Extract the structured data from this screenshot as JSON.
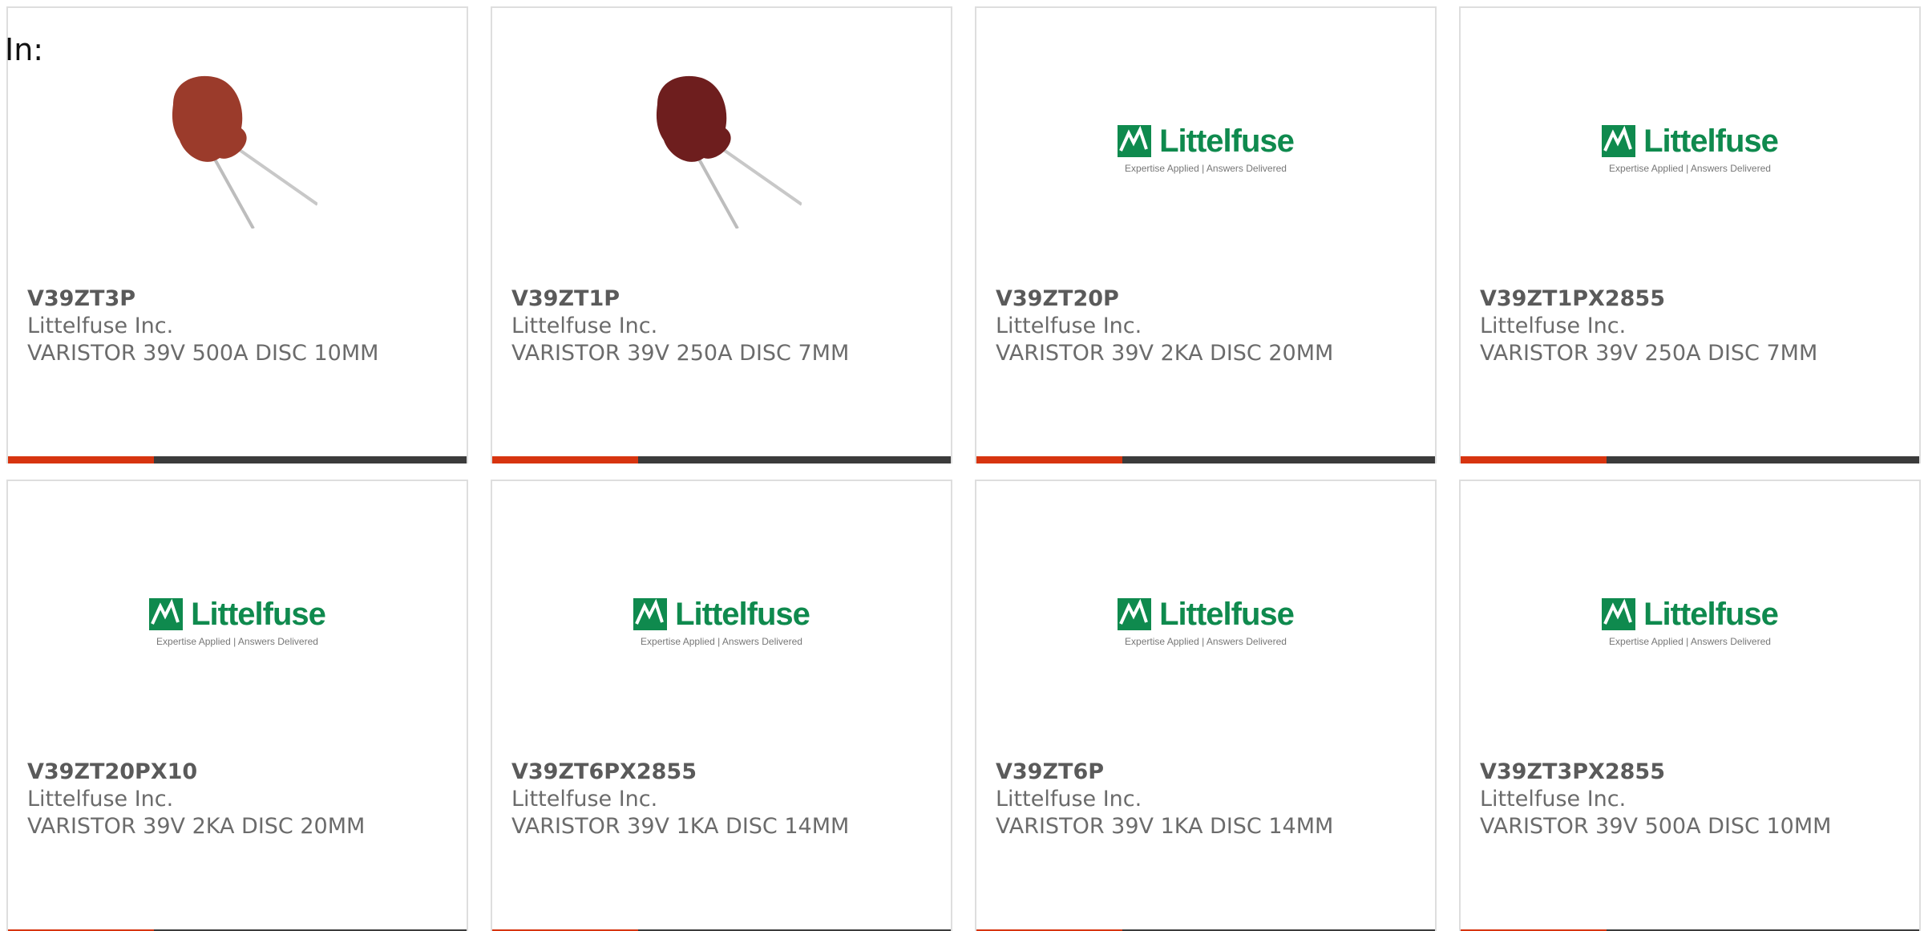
{
  "header": {
    "in_label": "In:"
  },
  "colors": {
    "accent": "#d7340f",
    "bar": "#3b3b3b",
    "brand_green": "#0f8a4e",
    "capacitor_light": "#9b3b2b",
    "capacitor_dark": "#6e1e1e"
  },
  "logo": {
    "word": "Littelfuse",
    "tagline": "Expertise Applied | Answers Delivered"
  },
  "cards": [
    {
      "part": "V39ZT3P",
      "mfr": "Littelfuse Inc.",
      "desc": "VARISTOR 39V 500A DISC 10MM",
      "image": "varistor-photo-light"
    },
    {
      "part": "V39ZT1P",
      "mfr": "Littelfuse Inc.",
      "desc": "VARISTOR 39V 250A DISC 7MM",
      "image": "varistor-photo-dark"
    },
    {
      "part": "V39ZT20P",
      "mfr": "Littelfuse Inc.",
      "desc": "VARISTOR 39V 2KA DISC 20MM",
      "image": "littelfuse-logo"
    },
    {
      "part": "V39ZT1PX2855",
      "mfr": "Littelfuse Inc.",
      "desc": "VARISTOR 39V 250A DISC 7MM",
      "image": "littelfuse-logo"
    },
    {
      "part": "V39ZT20PX10",
      "mfr": "Littelfuse Inc.",
      "desc": "VARISTOR 39V 2KA DISC 20MM",
      "image": "littelfuse-logo"
    },
    {
      "part": "V39ZT6PX2855",
      "mfr": "Littelfuse Inc.",
      "desc": "VARISTOR 39V 1KA DISC 14MM",
      "image": "littelfuse-logo"
    },
    {
      "part": "V39ZT6P",
      "mfr": "Littelfuse Inc.",
      "desc": "VARISTOR 39V 1KA DISC 14MM",
      "image": "littelfuse-logo"
    },
    {
      "part": "V39ZT3PX2855",
      "mfr": "Littelfuse Inc.",
      "desc": "VARISTOR 39V 500A DISC 10MM",
      "image": "littelfuse-logo"
    }
  ]
}
